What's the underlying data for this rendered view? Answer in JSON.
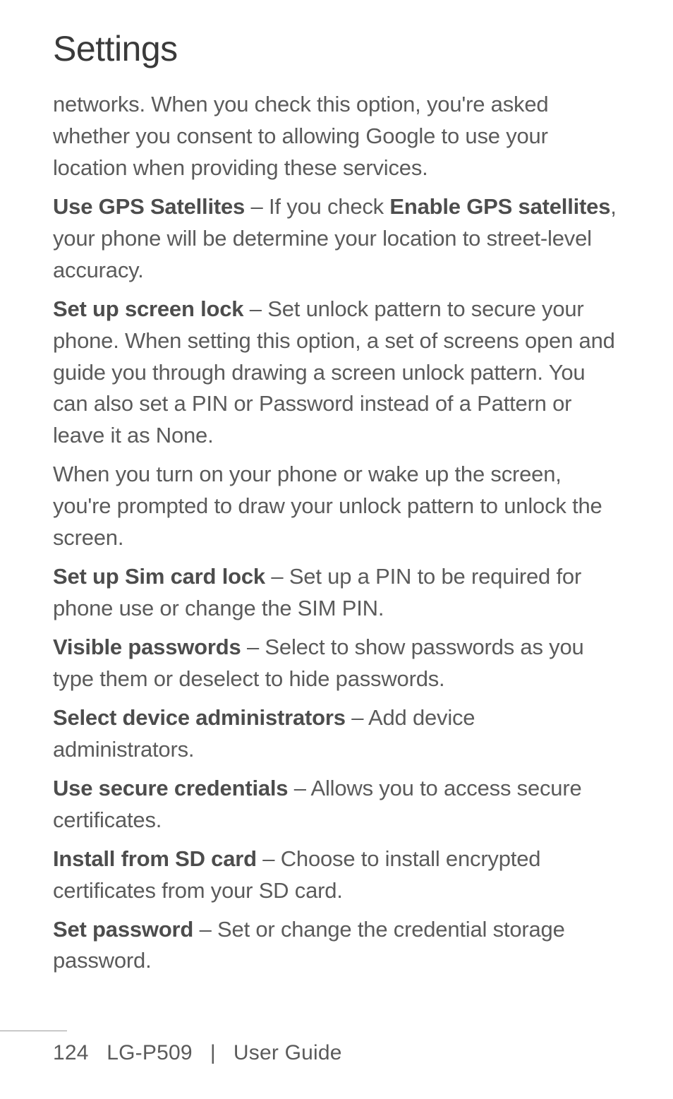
{
  "page": {
    "title": "Settings",
    "number": "124",
    "product": "LG-P509",
    "guide_label": "User Guide",
    "separator": "|"
  },
  "content": {
    "intro_continuation": "networks. When you check this option, you're asked whether you consent to allowing Google to use your location when providing these services.",
    "gps": {
      "label": "Use GPS Satellites",
      "sep": " – ",
      "text_before": "If you check ",
      "inline_bold": "Enable GPS satellites",
      "text_after": ", your phone will be determine your location to street-level accuracy."
    },
    "screen_lock": {
      "label": "Set up screen lock",
      "sep": " – ",
      "text": "Set unlock pattern to secure your phone. When setting this option, a set of screens open and guide you through drawing a screen unlock pattern. You can also set a PIN or Password instead of a Pattern or leave it as None."
    },
    "screen_lock_followup": "When you turn on your phone or wake up the screen, you're prompted to draw your unlock pattern to unlock the screen.",
    "sim_lock": {
      "label": "Set up Sim card lock",
      "sep": " – ",
      "text": "Set up a PIN to be required for phone use or change the SIM PIN."
    },
    "visible_passwords": {
      "label": "Visible passwords",
      "sep": " – ",
      "text": "Select to show passwords as you type them or deselect to hide passwords."
    },
    "device_admins": {
      "label": "Select device administrators",
      "sep": " – ",
      "text": "Add device administrators."
    },
    "secure_credentials": {
      "label": "Use secure credentials",
      "sep": " – ",
      "text": "Allows you to access secure certificates."
    },
    "install_sd": {
      "label": "Install from SD card",
      "sep": " – ",
      "text": "Choose to install encrypted certificates from your SD card."
    },
    "set_password": {
      "label": "Set password",
      "sep": " – ",
      "text": "Set or change the credential storage password."
    }
  }
}
